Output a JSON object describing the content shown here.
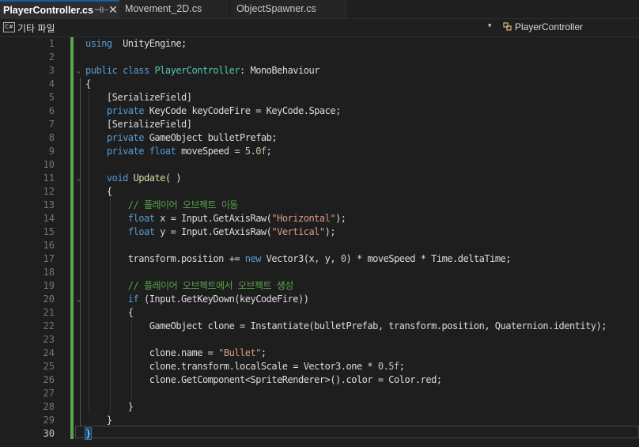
{
  "tabs": [
    {
      "label": "PlayerController.cs",
      "active": true,
      "pin_icon": "pin-icon",
      "close_glyph": "✕"
    },
    {
      "label": "Movement_2D.cs",
      "active": false
    },
    {
      "label": "ObjectSpawner.cs",
      "active": false
    }
  ],
  "navbar": {
    "project_icon_text": "C#",
    "project_label": "기타 파일",
    "member_label": "PlayerController",
    "dropdown_glyph": "▾"
  },
  "editor": {
    "current_line": 30,
    "colors": {
      "keyword": "#569cd6",
      "type": "#4ec9b0",
      "comment": "#57a64a",
      "string": "#d69d85",
      "number": "#b5cea8",
      "change_bar": "#57a64a"
    },
    "lines": [
      [
        [
          "kw",
          "using"
        ],
        [
          "",
          "  UnityEngine;"
        ]
      ],
      [],
      [
        [
          "kw",
          "public"
        ],
        [
          "",
          " "
        ],
        [
          "kw",
          "class"
        ],
        [
          "",
          " "
        ],
        [
          "ty",
          "PlayerController"
        ],
        [
          "",
          ": MonoBehaviour"
        ]
      ],
      [
        [
          "",
          "{"
        ]
      ],
      [
        [
          "",
          "    [SerializeField]"
        ]
      ],
      [
        [
          "",
          "    "
        ],
        [
          "kw",
          "private"
        ],
        [
          "",
          " KeyCode keyCodeFire = KeyCode.Space;"
        ]
      ],
      [
        [
          "",
          "    [SerializeField]"
        ]
      ],
      [
        [
          "",
          "    "
        ],
        [
          "kw",
          "private"
        ],
        [
          "",
          " GameObject bulletPrefab;"
        ]
      ],
      [
        [
          "",
          "    "
        ],
        [
          "kw",
          "private"
        ],
        [
          "",
          " "
        ],
        [
          "kw",
          "float"
        ],
        [
          "",
          " moveSpeed = "
        ],
        [
          "nu",
          "5.0f"
        ],
        [
          "",
          ";"
        ]
      ],
      [],
      [
        [
          "",
          "    "
        ],
        [
          "kw",
          "void"
        ],
        [
          "",
          " "
        ],
        [
          "fn",
          "Update"
        ],
        [
          "",
          "( )"
        ]
      ],
      [
        [
          "",
          "    {"
        ]
      ],
      [
        [
          "",
          "        "
        ],
        [
          "cm",
          "// 플레이어 오브젝트 이동"
        ]
      ],
      [
        [
          "",
          "        "
        ],
        [
          "kw",
          "float"
        ],
        [
          "",
          " x = Input.GetAxisRaw("
        ],
        [
          "st",
          "\"Horizontal\""
        ],
        [
          "",
          ");"
        ]
      ],
      [
        [
          "",
          "        "
        ],
        [
          "kw",
          "float"
        ],
        [
          "",
          " y = Input.GetAxisRaw("
        ],
        [
          "st",
          "\"Vertical\""
        ],
        [
          "",
          ");"
        ]
      ],
      [],
      [
        [
          "",
          "        transform.position += "
        ],
        [
          "kw",
          "new"
        ],
        [
          "",
          " Vector3(x, y, "
        ],
        [
          "nu",
          "0"
        ],
        [
          "",
          ") * moveSpeed * Time.deltaTime;"
        ]
      ],
      [],
      [
        [
          "",
          "        "
        ],
        [
          "cm",
          "// 플레이어 오브젝트에서 오브젝트 생성"
        ]
      ],
      [
        [
          "",
          "        "
        ],
        [
          "kw",
          "if"
        ],
        [
          "",
          " (Input.GetKeyDown(keyCodeFire))"
        ]
      ],
      [
        [
          "",
          "        {"
        ]
      ],
      [
        [
          "",
          "            GameObject clone = Instantiate(bulletPrefab, transform.position, Quaternion.identity);"
        ]
      ],
      [],
      [
        [
          "",
          "            clone.name = "
        ],
        [
          "st",
          "\"Bullet\""
        ],
        [
          "",
          ";"
        ]
      ],
      [
        [
          "",
          "            clone.transform.localScale = Vector3.one * "
        ],
        [
          "nu",
          "0.5f"
        ],
        [
          "",
          ";"
        ]
      ],
      [
        [
          "",
          "            clone.GetComponent<SpriteRenderer>().color = Color.red;"
        ]
      ],
      [],
      [
        [
          "",
          "        }"
        ]
      ],
      [
        [
          "",
          "    }"
        ]
      ],
      [
        [
          "",
          "}"
        ]
      ]
    ]
  }
}
